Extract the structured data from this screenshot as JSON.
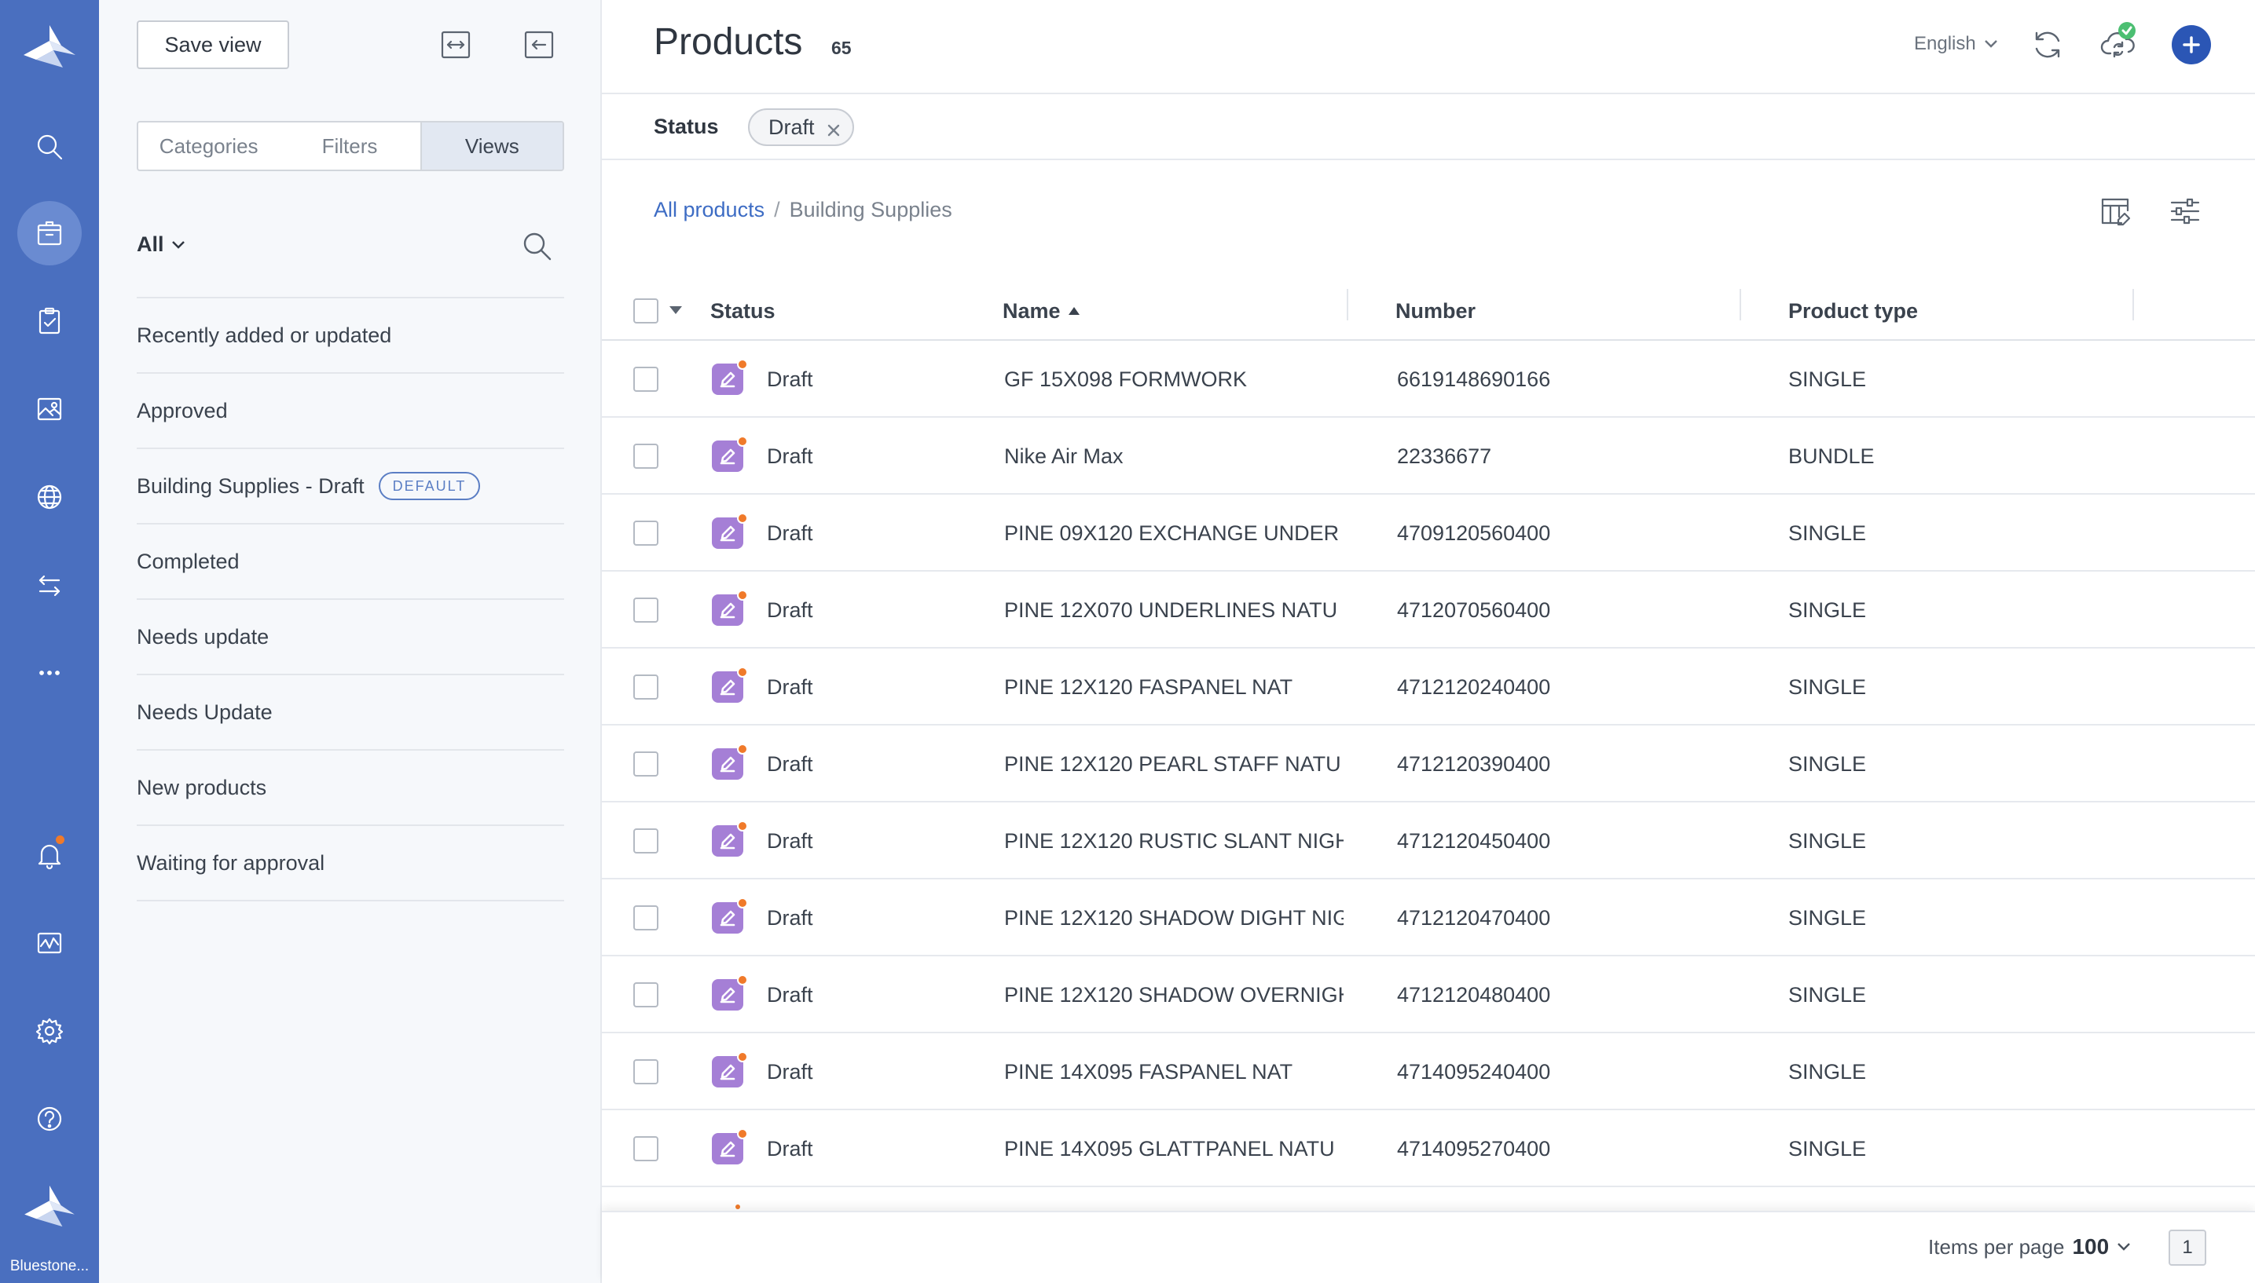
{
  "rail": {
    "org_name": "Bluestone...",
    "nav": [
      "search-icon",
      "products-icon",
      "tasks-icon",
      "media-icon",
      "globe-icon",
      "sync-arrows-icon",
      "more-icon",
      "bell-icon",
      "activity-icon",
      "gear-icon",
      "help-icon"
    ],
    "active": "products-icon"
  },
  "panel": {
    "save_view_label": "Save view",
    "tabs": [
      {
        "label": "Categories",
        "active": false
      },
      {
        "label": "Filters",
        "active": false
      },
      {
        "label": "Views",
        "active": true
      }
    ],
    "scope_label": "All",
    "views": [
      {
        "label": "Recently added or updated"
      },
      {
        "label": "Approved"
      },
      {
        "label": "Building Supplies - Draft",
        "badge": "DEFAULT"
      },
      {
        "label": "Completed"
      },
      {
        "label": "Needs update"
      },
      {
        "label": "Needs Update"
      },
      {
        "label": "New products"
      },
      {
        "label": "Waiting for approval"
      }
    ]
  },
  "header": {
    "title": "Products",
    "count": "65",
    "language": "English"
  },
  "filter": {
    "label": "Status",
    "chip": "Draft"
  },
  "breadcrumb": {
    "root": "All products",
    "separator": "/",
    "current": "Building Supplies"
  },
  "table": {
    "columns": {
      "status": "Status",
      "name": "Name",
      "number": "Number",
      "product_type": "Product type"
    },
    "rows": [
      {
        "status": "Draft",
        "name": "GF 15X098 FORMWORK",
        "number": "6619148690166",
        "type": "SINGLE"
      },
      {
        "status": "Draft",
        "name": "Nike Air Max",
        "number": "22336677",
        "type": "BUNDLE"
      },
      {
        "status": "Draft",
        "name": "PINE 09X120 EXCHANGE UNDER",
        "number": "4709120560400",
        "type": "SINGLE"
      },
      {
        "status": "Draft",
        "name": "PINE 12X070 UNDERLINES NATU",
        "number": "4712070560400",
        "type": "SINGLE"
      },
      {
        "status": "Draft",
        "name": "PINE 12X120 FASPANEL NAT",
        "number": "4712120240400",
        "type": "SINGLE"
      },
      {
        "status": "Draft",
        "name": "PINE 12X120 PEARL STAFF NATU",
        "number": "4712120390400",
        "type": "SINGLE"
      },
      {
        "status": "Draft",
        "name": "PINE 12X120 RUSTIC SLANT NIGH",
        "number": "4712120450400",
        "type": "SINGLE"
      },
      {
        "status": "Draft",
        "name": "PINE 12X120 SHADOW DIGHT NIG",
        "number": "4712120470400",
        "type": "SINGLE"
      },
      {
        "status": "Draft",
        "name": "PINE 12X120 SHADOW OVERNIGH",
        "number": "4712120480400",
        "type": "SINGLE"
      },
      {
        "status": "Draft",
        "name": "PINE 14X095 FASPANEL NAT",
        "number": "4714095240400",
        "type": "SINGLE"
      },
      {
        "status": "Draft",
        "name": "PINE 14X095 GLATTPANEL NATU",
        "number": "4714095270400",
        "type": "SINGLE"
      }
    ]
  },
  "footer": {
    "items_per_page_label": "Items per page",
    "items_per_page_value": "100",
    "page": "1"
  },
  "colors": {
    "rail": "#4a6fbf",
    "accent": "#2b56b5",
    "link": "#3d6cc4",
    "draft_icon": "#a57fd6",
    "notification_dot": "#f07a2a",
    "sync_ok": "#4cbf72"
  }
}
